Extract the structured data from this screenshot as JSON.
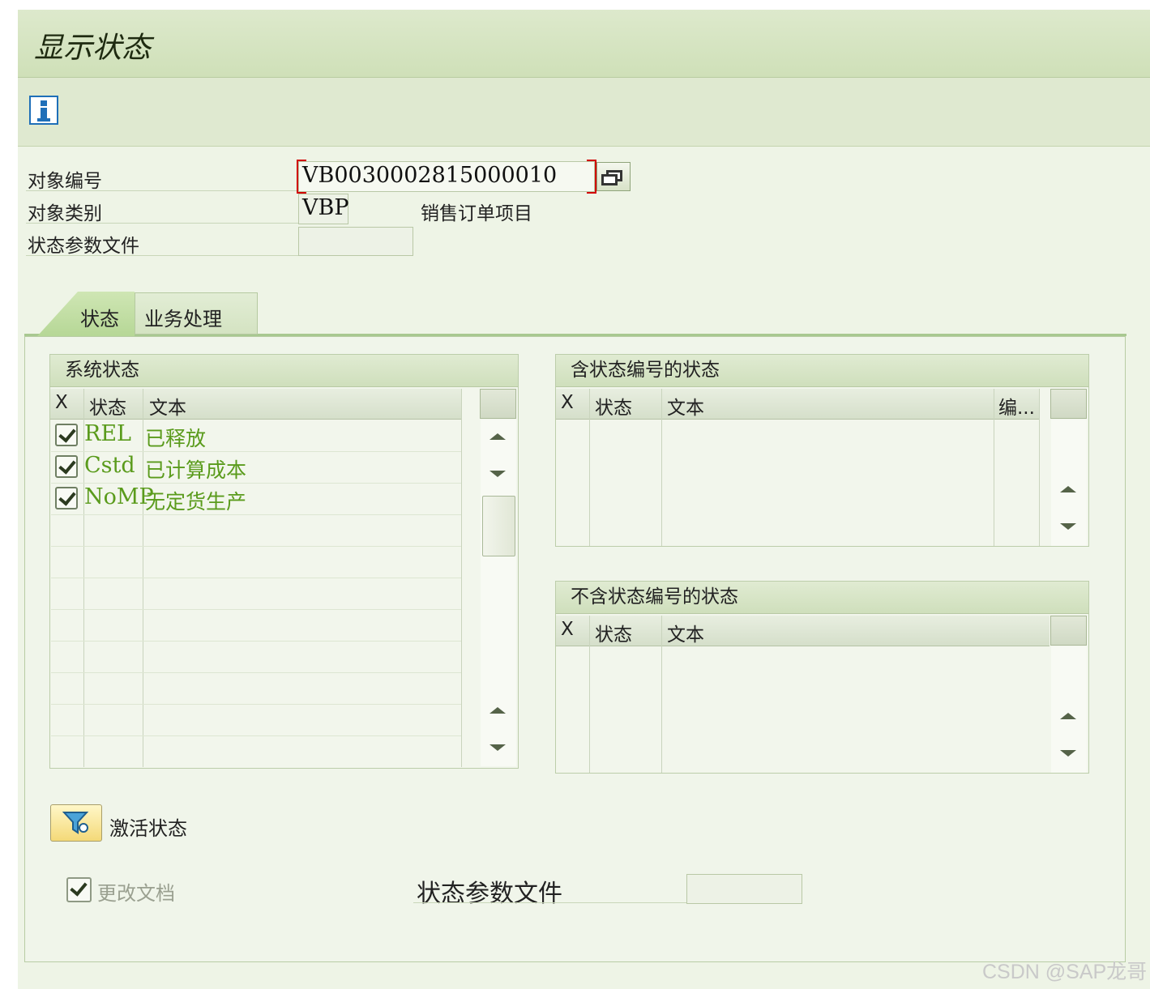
{
  "window": {
    "title": "显示状态"
  },
  "toolbar": {
    "info_icon": "info-icon"
  },
  "header": {
    "object_number_label": "对象编号",
    "object_number_value": "VB0030002815000010",
    "object_category_label": "对象类别",
    "object_category_value": "VBP",
    "object_category_desc": "销售订单项目",
    "status_profile_label": "状态参数文件",
    "status_profile_value": ""
  },
  "tabs": [
    {
      "label": "状态",
      "active": true
    },
    {
      "label": "业务处理",
      "active": false
    }
  ],
  "system_status": {
    "title": "系统状态",
    "columns": [
      "X",
      "状态",
      "文本"
    ],
    "rows": [
      {
        "checked": true,
        "status": "REL",
        "text": "已释放"
      },
      {
        "checked": true,
        "status": "Cstd",
        "text": "已计算成本"
      },
      {
        "checked": true,
        "status": "NoMP",
        "text": "无定货生产"
      }
    ]
  },
  "user_status_with_no": {
    "title": "含状态编号的状态",
    "columns": [
      "X",
      "状态",
      "文本",
      "编..."
    ],
    "rows": []
  },
  "user_status_without_no": {
    "title": "不含状态编号的状态",
    "columns": [
      "X",
      "状态",
      "文本"
    ],
    "rows": []
  },
  "actions": {
    "activate_status_label": "激活状态",
    "change_docs_label": "更改文档",
    "change_docs_checked": true,
    "status_profile_label2": "状态参数文件",
    "status_profile_value2": ""
  },
  "watermark": "CSDN @SAP龙哥",
  "colors": {
    "accent_green": "#5a9b1c",
    "focus_red": "#d10000",
    "info_blue": "#1f6fb8"
  }
}
